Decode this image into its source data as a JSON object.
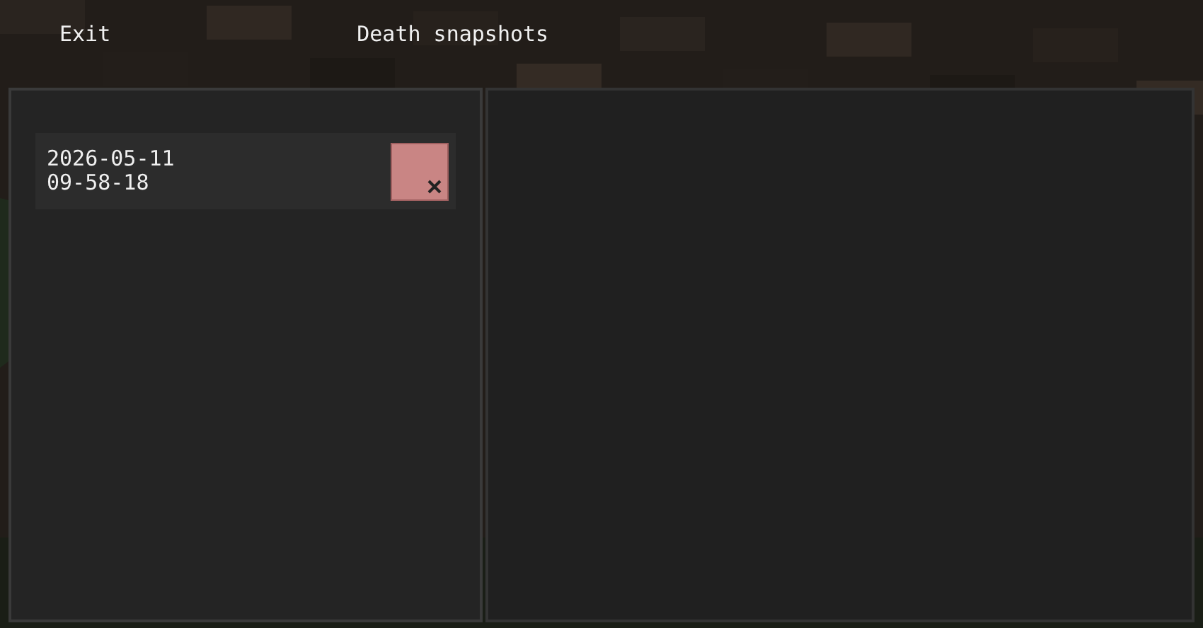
{
  "header": {
    "exit_button": "Exit",
    "title": "Death snapshots"
  },
  "snapshots": [
    {
      "date": "2026-05-11",
      "time": "09-58-18"
    }
  ]
}
